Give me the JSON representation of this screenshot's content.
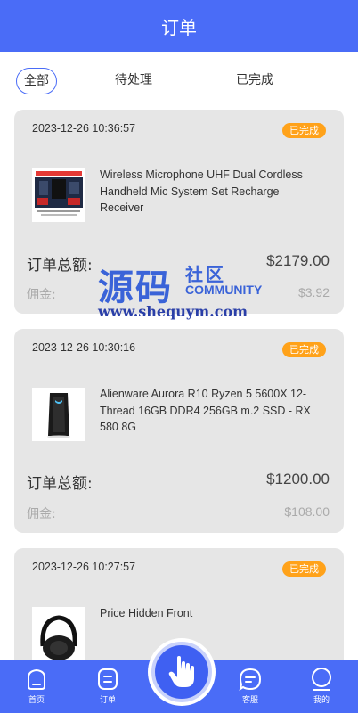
{
  "header": {
    "title": "订单"
  },
  "tabs": [
    {
      "label": "全部",
      "active": true
    },
    {
      "label": "待处理",
      "active": false
    },
    {
      "label": "已完成",
      "active": false
    }
  ],
  "orders": [
    {
      "time": "2023-12-26 10:36:57",
      "status": "已完成",
      "product": "Wireless Microphone UHF Dual Cordless Handheld Mic System Set Recharge Receiver",
      "total_label": "订单总额:",
      "total": "$2179.00",
      "commission_label": "佣金:",
      "commission": "$3.92"
    },
    {
      "time": "2023-12-26 10:30:16",
      "status": "已完成",
      "product": "Alienware Aurora R10 Ryzen 5 5600X 12-Thread 16GB DDR4 256GB m.2 SSD - RX 580 8G",
      "total_label": "订单总额:",
      "total": "$1200.00",
      "commission_label": "佣金:",
      "commission": "$108.00"
    },
    {
      "time": "2023-12-26 10:27:57",
      "status": "已完成",
      "product": "Price Hidden Front"
    }
  ],
  "watermark": {
    "cn_big": "源码",
    "cn_small": "社区",
    "en": "COMMUNITY",
    "url": "www.shequym.com"
  },
  "bottom_nav": [
    {
      "label": "首页",
      "icon": "home-icon"
    },
    {
      "label": "订单",
      "icon": "orders-icon"
    },
    {
      "label": "",
      "icon": "hand-pointer-icon"
    },
    {
      "label": "客服",
      "icon": "chat-icon"
    },
    {
      "label": "我的",
      "icon": "profile-icon"
    }
  ],
  "colors": {
    "primary": "#4a6cf7",
    "badge": "#ffa21a",
    "card": "#e6e6e6"
  }
}
